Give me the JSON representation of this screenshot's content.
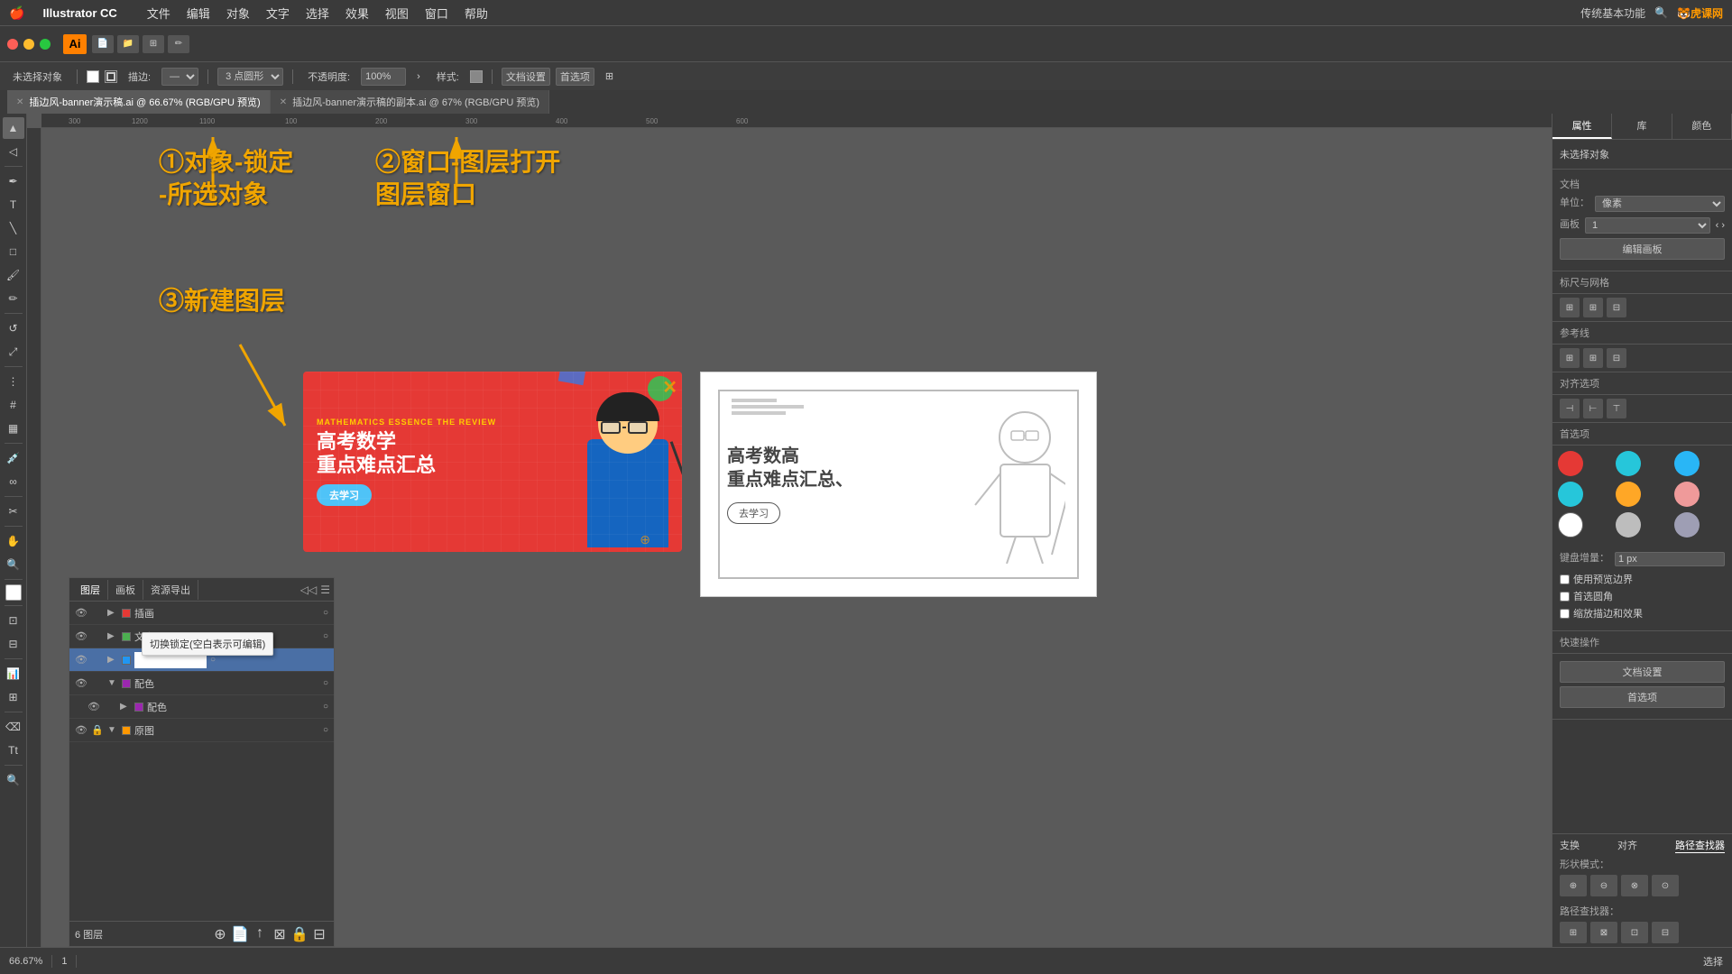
{
  "app": {
    "name": "Illustrator CC",
    "logo": "Ai",
    "zoom": "66.67%",
    "page": "1",
    "mode": "选择"
  },
  "menubar": {
    "apple": "🍎",
    "items": [
      "Illustrator CC",
      "文件",
      "编辑",
      "对象",
      "文字",
      "选择",
      "效果",
      "视图",
      "窗口",
      "帮助"
    ]
  },
  "tabs": [
    {
      "name": "插边风-banner演示稿.ai",
      "detail": "@ 66.67% (RGB/GPU 预览)",
      "active": true
    },
    {
      "name": "插边风-banner演示稿的副本.ai",
      "detail": "@ 67% (RGB/GPU 预览)",
      "active": false
    }
  ],
  "toolbar": {
    "no_selection": "未选择对象",
    "stroke_label": "描边:",
    "shape_label": "3 点圆形",
    "opacity_label": "不透明度:",
    "opacity_value": "100%",
    "style_label": "样式:",
    "doc_settings": "文档设置",
    "prefs": "首选项"
  },
  "annotations": {
    "text1_line1": "①对象-锁定",
    "text1_line2": "-所选对象",
    "text2_line1": "②窗口-图层打开",
    "text2_line2": "图层窗口",
    "text3": "③新建图层"
  },
  "layers_panel": {
    "title": "图层",
    "tabs": [
      "图层",
      "画板",
      "资源导出"
    ],
    "layers": [
      {
        "name": "插画",
        "visible": true,
        "locked": false,
        "expanded": false,
        "color": "#e53935"
      },
      {
        "name": "文字",
        "visible": true,
        "locked": false,
        "expanded": false,
        "color": "#4caf50"
      },
      {
        "name": "",
        "visible": true,
        "locked": false,
        "expanded": false,
        "color": "#2196f3",
        "editing": true
      },
      {
        "name": "配色",
        "visible": true,
        "locked": false,
        "expanded": true,
        "color": "#9c27b0"
      },
      {
        "name": "配色",
        "visible": true,
        "locked": false,
        "expanded": false,
        "color": "#9c27b0",
        "indent": true
      },
      {
        "name": "原图",
        "visible": true,
        "locked": true,
        "expanded": true,
        "color": "#ff9800"
      }
    ],
    "footer_text": "6 图层",
    "footer_buttons": [
      "⊕",
      "📄",
      "↩",
      "⊠",
      "🔒",
      "⊟"
    ]
  },
  "right_panel": {
    "tabs": [
      "属性",
      "库",
      "颜色"
    ],
    "no_selection": "未选择对象",
    "doc_section": {
      "label": "文档",
      "unit_label": "单位：",
      "unit_value": "像素",
      "artboard_label": "画板",
      "artboard_value": "1"
    },
    "colors": [
      "#e53935",
      "#26c6da",
      "#29b6f6",
      "#26c6da",
      "#ffa726",
      "#ef9a9a",
      "#ffffff",
      "#bdbdbd",
      "#9e9eb4"
    ],
    "edit_artboard_btn": "编辑画板",
    "align_section": "标尺与网格",
    "ref_section": "参考线",
    "align_objects": "对齐选项",
    "snapping": "首选项",
    "keyboard_increment": "键盘增量：",
    "keyboard_value": "1 px",
    "use_preview_bounds": "使用预览边界",
    "round_corners": "首选圆角",
    "scale_effects": "缩放描边和效果",
    "quick_actions": "快速操作",
    "doc_settings_btn": "文档设置",
    "prefs_btn": "首选项"
  },
  "bottom_panel": {
    "title": "路径查找器",
    "shape_modes_label": "形状模式：",
    "path_finder_label": "路径查找器："
  },
  "status_bar": {
    "zoom": "66.67%",
    "page": "1",
    "mode": "选择"
  },
  "tooltip": {
    "text": "切换锁定(空白表示可编辑)"
  }
}
